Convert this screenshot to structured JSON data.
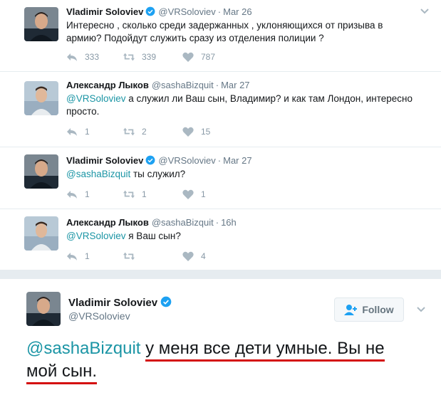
{
  "tweets": [
    {
      "name": "Vladimir Soloviev",
      "verified": true,
      "handle": "@VRSoloviev",
      "time": "Mar 26",
      "mention": "",
      "text": "Интересно , сколько среди задержанных , уклоняющихся от призыва в армию? Подойдут служить сразу из отделения полиции ?",
      "replies": "333",
      "retweets": "339",
      "likes": "787"
    },
    {
      "name": "Александр Лыков",
      "verified": false,
      "handle": "@sashaBizquit",
      "time": "Mar 27",
      "mention": "@VRSoloviev",
      "text": " а служил ли Ваш сын, Владимир? и как там Лондон, интересно просто.",
      "replies": "1",
      "retweets": "2",
      "likes": "15"
    },
    {
      "name": "Vladimir Soloviev",
      "verified": true,
      "handle": "@VRSoloviev",
      "time": "Mar 27",
      "mention": "@sashaBizquit",
      "text": " ты служил?",
      "replies": "1",
      "retweets": "1",
      "likes": "1"
    },
    {
      "name": "Александр Лыков",
      "verified": false,
      "handle": "@sashaBizquit",
      "time": "16h",
      "mention": "@VRSoloviev",
      "text": " я Ваш сын?",
      "replies": "1",
      "retweets": "",
      "likes": "4"
    }
  ],
  "expanded": {
    "name": "Vladimir Soloviev",
    "handle": "@VRSoloviev",
    "follow_label": "Follow",
    "mention": "@sashaBizquit",
    "text_line1": "у меня все дети умные. Вы не",
    "text_line2": "мой сын."
  },
  "colors": {
    "accent": "#1b95a5",
    "verified": "#1da1f2",
    "underline": "#d40f0f",
    "muted": "#657786"
  }
}
